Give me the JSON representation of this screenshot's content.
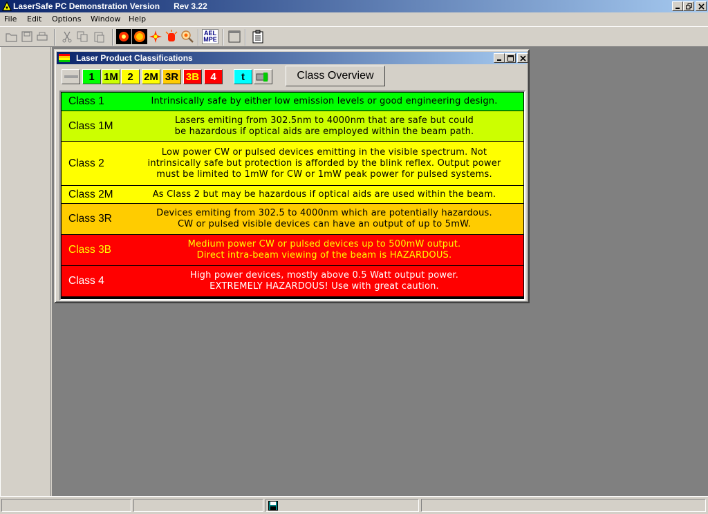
{
  "app": {
    "title": "LaserSafe PC Demonstration Version      Rev 3.22"
  },
  "menu": [
    "File",
    "Edit",
    "Options",
    "Window",
    "Help"
  ],
  "toolbar": {
    "ael_mpe_top": "AEL",
    "ael_mpe_bottom": "MPE"
  },
  "child_window": {
    "title": "Laser Product Classifications",
    "class_buttons": [
      {
        "label": "1",
        "bg": "#00ff00",
        "fg": "#000000"
      },
      {
        "label": "1M",
        "bg": "#ccff00",
        "fg": "#000000"
      },
      {
        "label": "2",
        "bg": "#ffff00",
        "fg": "#000000"
      },
      {
        "label": "2M",
        "bg": "#ffff00",
        "fg": "#000000"
      },
      {
        "label": "3R",
        "bg": "#ffcc00",
        "fg": "#000000"
      },
      {
        "label": "3B",
        "bg": "#ff0000",
        "fg": "#ffff00"
      },
      {
        "label": "4",
        "bg": "#ff0000",
        "fg": "#ffffff"
      }
    ],
    "t_button": "t",
    "overview_button": "Class Overview",
    "rows": [
      {
        "name": "Class 1",
        "desc": "Intrinsically safe by either low emission levels or good engineering design.",
        "bg": "#00ff00",
        "fg": "#000000"
      },
      {
        "name": "Class 1M",
        "desc": "Lasers emiting from 302.5nm to 4000nm that are safe but could\nbe hazardous if optical aids are employed within the beam path.",
        "bg": "#ccff00",
        "fg": "#000000"
      },
      {
        "name": "Class 2",
        "desc": "Low power CW or pulsed devices emitting in the visible spectrum.  Not\nintrinsically safe but protection is afforded by the blink reflex.  Output power\nmust be limited to 1mW for CW or 1mW peak power for pulsed systems.",
        "bg": "#ffff00",
        "fg": "#000000"
      },
      {
        "name": "Class 2M",
        "desc": "As Class 2 but may be hazardous if optical aids are used within the beam.",
        "bg": "#ffff00",
        "fg": "#000000"
      },
      {
        "name": "Class 3R",
        "desc": "Devices emiting from 302.5 to 4000nm which are potentially hazardous.\nCW or pulsed visible devices can have an output of up to 5mW.",
        "bg": "#ffcc00",
        "fg": "#000000"
      },
      {
        "name": "Class 3B",
        "desc": "Medium power CW or pulsed devices up to 500mW output.\nDirect intra-beam viewing of the beam is  HAZARDOUS.",
        "bg": "#ff0000",
        "fg": "#ffff00"
      },
      {
        "name": "Class 4",
        "desc": "High power devices, mostly above 0.5 Watt output power.\nEXTREMELY HAZARDOUS!      Use with great caution.",
        "bg": "#ff0000",
        "fg": "#ffffff"
      }
    ]
  }
}
